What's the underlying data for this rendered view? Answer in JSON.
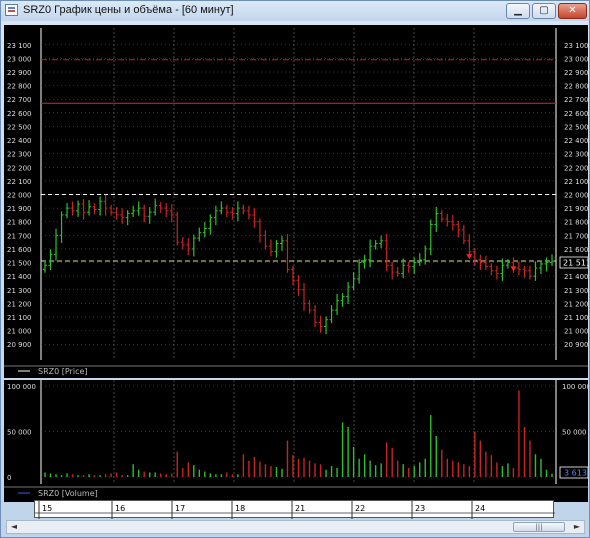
{
  "window": {
    "title": "SRZ0 График цены и объёма - [60 минут]",
    "buttons": {
      "minimize": "▁",
      "maximize": "▢",
      "close": "✕"
    }
  },
  "price_panel": {
    "legend": "SRZ0 [Price]",
    "y_ticks": [
      "23 100",
      "23 000",
      "22 900",
      "22 800",
      "22 700",
      "22 600",
      "22 500",
      "22 400",
      "22 300",
      "22 200",
      "22 100",
      "22 000",
      "21 900",
      "21 800",
      "21 700",
      "21 600",
      "21 500",
      "21 400",
      "21 300",
      "21 200",
      "21 100",
      "21 000",
      "20 900"
    ],
    "current_price_label": "21 511",
    "colors": {
      "up": "#2fbf2f",
      "down": "#c72424",
      "level_line": "#c81e1e",
      "white_dashed": "#ffffff",
      "yellow_dashed": "#e0e080"
    }
  },
  "volume_panel": {
    "legend": "SRZ0 [Volume]",
    "y_ticks_left": [
      "100 000",
      "50 000",
      "0"
    ],
    "y_ticks_right": [
      "100 000",
      "50 000"
    ],
    "current_volume_label": "3 613"
  },
  "date_axis": {
    "labels": [
      "15",
      "16",
      "17",
      "18",
      "21",
      "22",
      "23",
      "24"
    ]
  },
  "scrollbar": {
    "left": "◄",
    "right": "►",
    "grip": "|||"
  },
  "chart_data": [
    {
      "type": "line",
      "y_unit": "price",
      "ylim": [
        20850,
        23150
      ],
      "horizontal_levels": {
        "red_solid": 22670,
        "red_dashdot": 22990,
        "white_dashed": 22000,
        "yellow_dashed": 21511
      },
      "last_value": 21511,
      "series": [
        {
          "values": [
            21480,
            21560,
            21700,
            21850,
            21900,
            21880,
            21930,
            21870,
            21910,
            21890,
            21950,
            21900,
            21870,
            21850,
            21830,
            21860,
            21880,
            21900,
            21840,
            21870,
            21920,
            21900,
            21880,
            21850,
            21650,
            21630,
            21600,
            21680,
            21720,
            21750,
            21830,
            21880,
            21900,
            21870,
            21860,
            21900,
            21880,
            21850,
            21800,
            21700,
            21620,
            21580,
            21640,
            21660,
            21450,
            21370,
            21300,
            21200,
            21150,
            21060,
            21030,
            21080,
            21150,
            21220,
            21250,
            21320,
            21380,
            21500,
            21520,
            21620,
            21640,
            21660,
            21480,
            21430,
            21420,
            21480,
            21470,
            21500,
            21520,
            21600,
            21780,
            21860,
            21820,
            21800,
            21780,
            21740,
            21660,
            21580,
            21520,
            21500,
            21470,
            21440,
            21420,
            21480,
            21500,
            21460,
            21450,
            21440,
            21400,
            21460,
            21490,
            21500,
            21511
          ]
        }
      ]
    },
    {
      "type": "bar",
      "y_unit": "contracts",
      "ylim": [
        0,
        100000
      ],
      "last_value": 3613,
      "series": [
        {
          "values": [
            5000,
            4000,
            3000,
            2000,
            4000,
            3000,
            2000,
            2000,
            3000,
            2000,
            2000,
            3000,
            4000,
            5000,
            2000,
            2000,
            14000,
            8000,
            6000,
            5000,
            5000,
            4000,
            3000,
            4000,
            28000,
            10000,
            16000,
            13000,
            8000,
            6000,
            4000,
            3000,
            3000,
            5000,
            3000,
            3000,
            25000,
            18000,
            22000,
            17000,
            14000,
            12000,
            11000,
            9000,
            40000,
            24000,
            20000,
            21000,
            18000,
            15000,
            14000,
            8000,
            12000,
            10000,
            60000,
            55000,
            33000,
            20000,
            25000,
            18000,
            13000,
            15000,
            38000,
            32000,
            18000,
            14000,
            10000,
            12000,
            16000,
            20000,
            68000,
            45000,
            30000,
            20000,
            18000,
            16000,
            14000,
            12000,
            50000,
            40000,
            28000,
            24000,
            16000,
            12000,
            15000,
            10000,
            95000,
            55000,
            40000,
            25000,
            20000,
            8000,
            3613
          ]
        }
      ]
    }
  ]
}
